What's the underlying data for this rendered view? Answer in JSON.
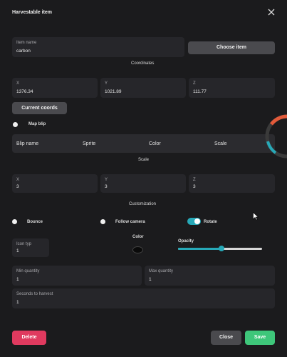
{
  "dialog": {
    "title": "Harvestable item",
    "close_icon": "close-icon"
  },
  "item_name": {
    "label": "Item name",
    "value": "carbon"
  },
  "choose_item_button": "Choose item",
  "coordinates": {
    "title": "Coordinates",
    "x": {
      "label": "X",
      "value": "1376.34"
    },
    "y": {
      "label": "Y",
      "value": "1021.89"
    },
    "z": {
      "label": "Z",
      "value": "111.77"
    }
  },
  "current_coords_button": "Current coords",
  "map_blip": {
    "label": "Map blip",
    "columns": [
      "Blip name",
      "Sprite",
      "Color",
      "Scale"
    ],
    "scale_label": "Scale"
  },
  "scale_fields": {
    "x": {
      "label": "X",
      "value": "3"
    },
    "y": {
      "label": "Y",
      "value": "3"
    },
    "z": {
      "label": "Z",
      "value": "3"
    }
  },
  "customization": {
    "title": "Customization",
    "bounce_label": "Bounce",
    "follow_camera_label": "Follow camera",
    "rotate_label": "Rotate",
    "rotate_on": true,
    "icon_type_label": "Icon typ",
    "icon_type_value": "1",
    "color_label": "Color",
    "opacity_label": "Opacity",
    "opacity_fraction": 0.52
  },
  "min_quantity": {
    "label": "Min quantity",
    "value": "1"
  },
  "max_quantity": {
    "label": "Max quantity",
    "value": "1"
  },
  "seconds_to_harvest": {
    "label": "Seconds to harvest",
    "value": "1"
  },
  "footer": {
    "delete_label": "Delete",
    "close_label": "Close",
    "save_label": "Save"
  },
  "colors": {
    "accent": "#27a9b8",
    "delete": "#e03a5f",
    "save": "#3ec67a"
  }
}
